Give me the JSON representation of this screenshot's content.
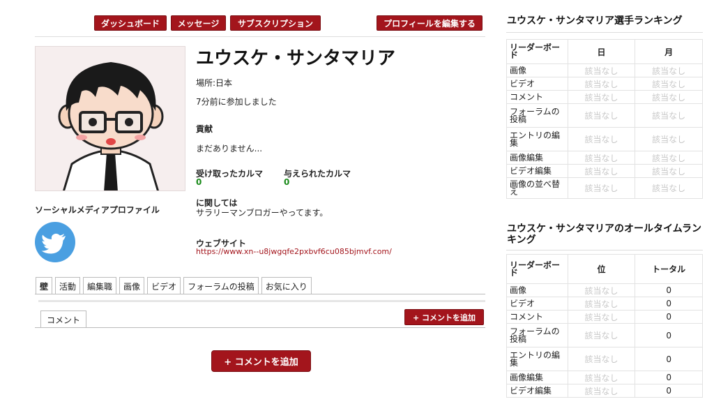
{
  "topnav": {
    "dashboard": "ダッシュボード",
    "messages": "メッセージ",
    "subscriptions": "サブスクリプション",
    "edit_profile": "プロフィールを編集する"
  },
  "profile": {
    "name": "ユウスケ・サンタマリア",
    "location": "場所:日本",
    "joined": "7分前に参加しました",
    "contributions_label": "貢献",
    "contributions_value": "まだありません...",
    "karma_received_label": "受け取ったカルマ",
    "karma_received_value": "0",
    "karma_given_label": "与えられたカルマ",
    "karma_given_value": "0",
    "about_label": "に関しては",
    "about_value": "サラリーマンブロガーやってます。",
    "website_label": "ウェブサイト",
    "website_url": "https://www.xn--u8jwgqfe2pxbvf6cu085bjmvf.com/",
    "social_label": "ソーシャルメディアプロファイル",
    "social_icon": "twitter-icon"
  },
  "tabs": [
    "壁",
    "活動",
    "編集職",
    "画像",
    "ビデオ",
    "フォーラムの投稿",
    "お気に入り"
  ],
  "comments": {
    "tab_label": "コメント",
    "add_small": "+ コメントを追加",
    "add_large": "+ コメントを追加"
  },
  "ranking_period": {
    "title": "ユウスケ・サンタマリア選手ランキング",
    "headers": [
      "リーダーボード",
      "日",
      "月"
    ],
    "rows": [
      [
        "画像",
        "該当なし",
        "該当なし"
      ],
      [
        "ビデオ",
        "該当なし",
        "該当なし"
      ],
      [
        "コメント",
        "該当なし",
        "該当なし"
      ],
      [
        "フォーラムの投稿",
        "該当なし",
        "該当なし"
      ],
      [
        "エントリの編集",
        "該当なし",
        "該当なし"
      ],
      [
        "画像編集",
        "該当なし",
        "該当なし"
      ],
      [
        "ビデオ編集",
        "該当なし",
        "該当なし"
      ],
      [
        "画像の並べ替え",
        "該当なし",
        "該当なし"
      ]
    ]
  },
  "ranking_alltime": {
    "title": "ユウスケ・サンタマリアのオールタイムランキング",
    "headers": [
      "リーダーボード",
      "位",
      "トータル"
    ],
    "rows": [
      [
        "画像",
        "該当なし",
        "0"
      ],
      [
        "ビデオ",
        "該当なし",
        "0"
      ],
      [
        "コメント",
        "該当なし",
        "0"
      ],
      [
        "フォーラムの投稿",
        "該当なし",
        "0"
      ],
      [
        "エントリの編集",
        "該当なし",
        "0"
      ],
      [
        "画像編集",
        "該当なし",
        "0"
      ],
      [
        "ビデオ編集",
        "該当なし",
        "0"
      ]
    ]
  },
  "colors": {
    "accent": "#a3151c",
    "karma": "#1a8a1a",
    "link": "#a3151c",
    "na": "#c7c7c7",
    "twitter": "#4a9fe1"
  }
}
